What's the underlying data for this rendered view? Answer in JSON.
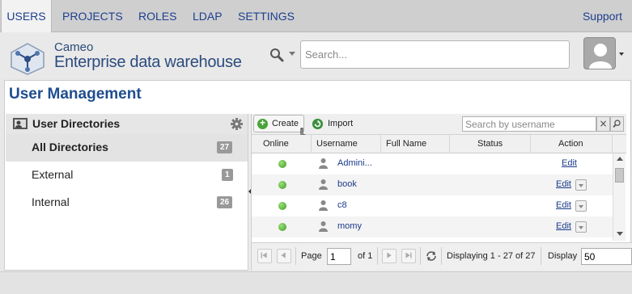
{
  "nav": {
    "tabs": [
      {
        "label": "USERS"
      },
      {
        "label": "PROJECTS"
      },
      {
        "label": "ROLES"
      },
      {
        "label": "LDAP"
      },
      {
        "label": "SETTINGS"
      }
    ],
    "support": "Support"
  },
  "brand": {
    "line1": "Cameo",
    "line2": "Enterprise data warehouse"
  },
  "search": {
    "placeholder": "Search..."
  },
  "page": {
    "title": "User Management"
  },
  "directories": {
    "title": "User Directories",
    "items": [
      {
        "label": "All Directories",
        "count": "27"
      },
      {
        "label": "External",
        "count": "1"
      },
      {
        "label": "Internal",
        "count": "26"
      }
    ]
  },
  "toolbar": {
    "create": "Create",
    "import": "Import",
    "search_placeholder": "Search by username",
    "clear": "×"
  },
  "grid": {
    "columns": [
      "Online",
      "Username",
      "Full Name",
      "Status",
      "Action"
    ],
    "rows": [
      {
        "username": "Admini...",
        "action": "Edit"
      },
      {
        "username": "book",
        "action": "Edit"
      },
      {
        "username": "c8",
        "action": "Edit"
      },
      {
        "username": "momy",
        "action": "Edit"
      }
    ]
  },
  "pager": {
    "page_label": "Page",
    "page_value": "1",
    "of": "of 1",
    "displaying": "Displaying 1 - 27 of 27",
    "display_label": "Display",
    "display_value": "50"
  },
  "colors": {
    "accent": "#1f4e8f",
    "nav_bg": "#cfcfcf",
    "online": "#4aa33b"
  }
}
